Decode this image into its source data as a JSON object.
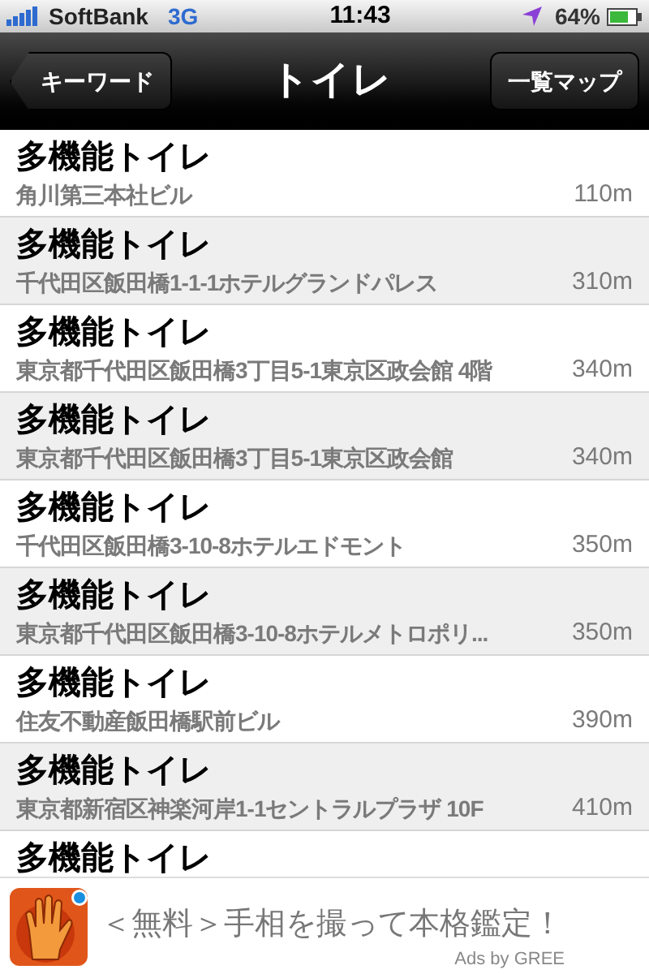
{
  "status_bar": {
    "carrier": "SoftBank",
    "network": "3G",
    "time": "11:43",
    "battery": "64%"
  },
  "nav_bar": {
    "back_button": "キーワード",
    "title": "トイレ",
    "right_button": "一覧マップ"
  },
  "rows": [
    {
      "title": "多機能トイレ",
      "address": "角川第三本社ビル",
      "distance": "110m"
    },
    {
      "title": "多機能トイレ",
      "address": "千代田区飯田橋1-1-1ホテルグランドパレス",
      "distance": "310m"
    },
    {
      "title": "多機能トイレ",
      "address": "東京都千代田区飯田橋3丁目5-1東京区政会館 4階",
      "distance": "340m"
    },
    {
      "title": "多機能トイレ",
      "address": "東京都千代田区飯田橋3丁目5-1東京区政会館",
      "distance": "340m"
    },
    {
      "title": "多機能トイレ",
      "address": "千代田区飯田橋3-10-8ホテルエドモント",
      "distance": "350m"
    },
    {
      "title": "多機能トイレ",
      "address": "東京都千代田区飯田橋3-10-8ホテルメトロポリ...",
      "distance": "350m"
    },
    {
      "title": "多機能トイレ",
      "address": "住友不動産飯田橋駅前ビル",
      "distance": "390m"
    },
    {
      "title": "多機能トイレ",
      "address": "東京都新宿区神楽河岸1-1セントラルプラザ 10F",
      "distance": "410m"
    },
    {
      "title": "多機能トイレ"
    }
  ],
  "ad": {
    "text": "＜無料＞手相を撮って本格鑑定！",
    "credit": "Ads by GREE"
  }
}
